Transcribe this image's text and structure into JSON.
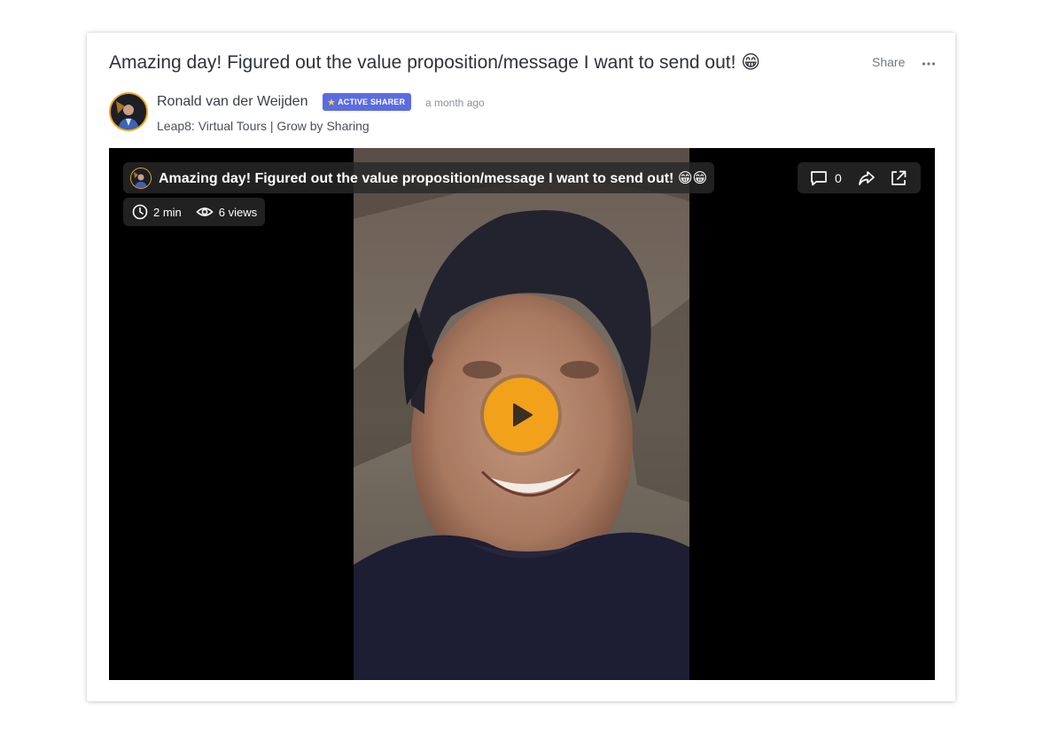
{
  "post": {
    "title": "Amazing day! Figured out the value proposition/message I want to send out! 😁",
    "share_label": "Share",
    "more_label": "More options"
  },
  "author": {
    "name": "Ronald van der Weijden",
    "badge": "ACTIVE SHARER",
    "timestamp": "a month ago",
    "space": "Leap8: Virtual Tours | Grow by Sharing"
  },
  "video": {
    "title": "Amazing day! Figured out the value proposition/message I want to send out! 😁😁",
    "duration": "2 min",
    "views": "6 views",
    "comment_count": "0"
  },
  "colors": {
    "accent": "#f2a11a",
    "badge": "#5b6ce2",
    "title_text": "#2e3238",
    "muted_text": "#6f7782"
  },
  "icons": [
    "ellipsis-icon",
    "star-icon",
    "clock-icon",
    "eye-icon",
    "comment-icon",
    "share-arrow-icon",
    "external-link-icon",
    "play-icon"
  ]
}
